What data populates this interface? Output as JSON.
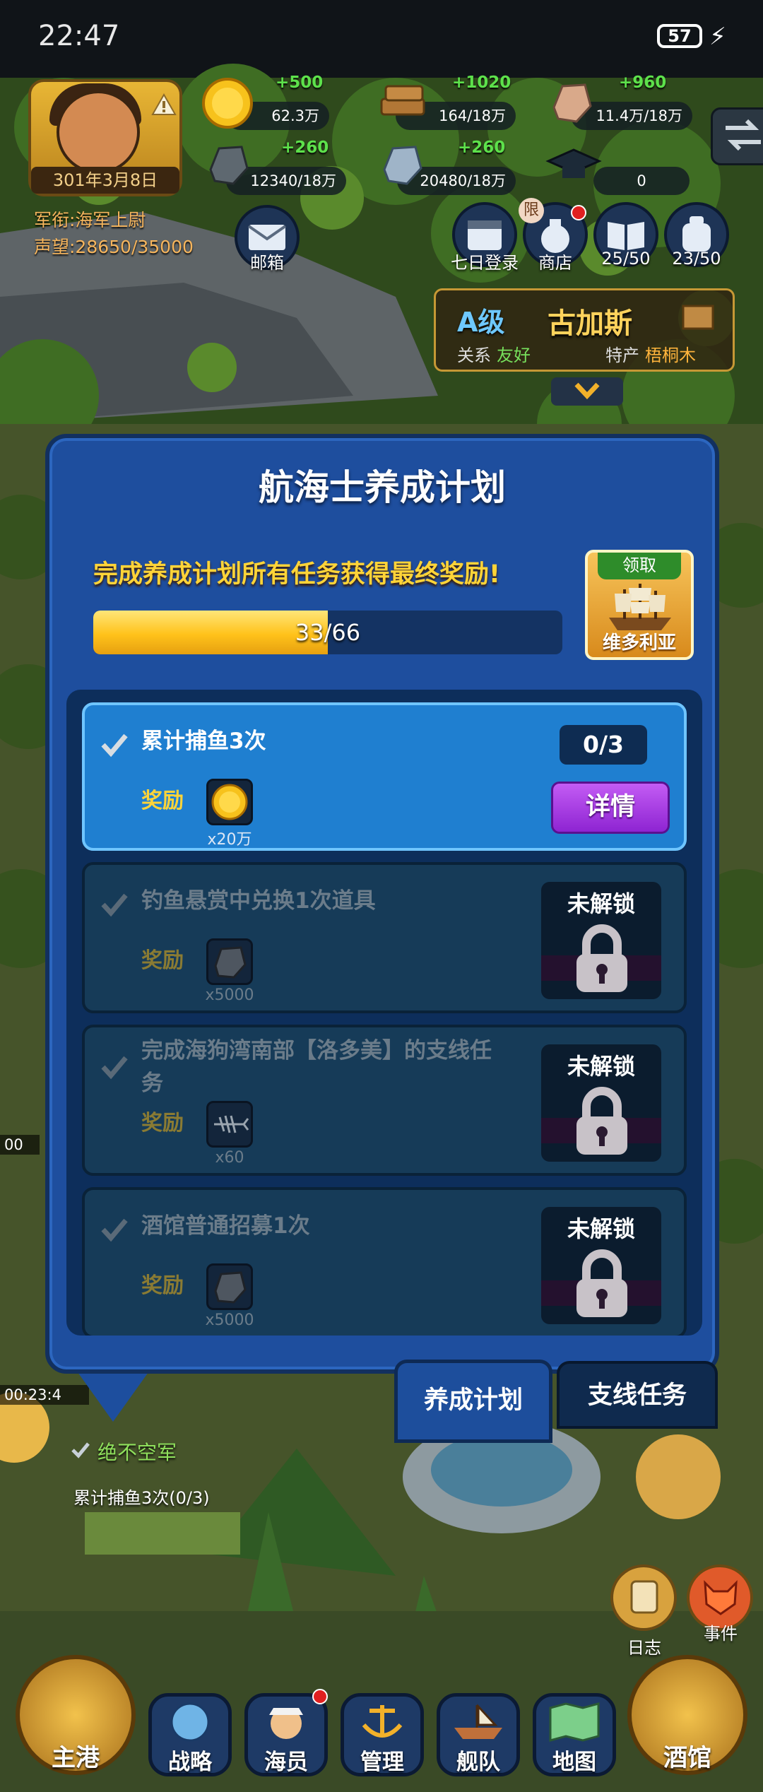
{
  "status_bar": {
    "time": "22:47",
    "battery": "57"
  },
  "player": {
    "date": "301年3月8日",
    "rank": "军衔:海军上尉",
    "prestige": "声望:28650/35000"
  },
  "resources": [
    {
      "icon": "gold-coin-icon",
      "plus": "+500",
      "value": "62.3万"
    },
    {
      "icon": "wood-icon",
      "plus": "+1020",
      "value": "164/18万"
    },
    {
      "icon": "stone-icon",
      "plus": "+960",
      "value": "11.4万/18万"
    },
    {
      "icon": "iron-ore-icon",
      "plus": "+260",
      "value": "12340/18万"
    },
    {
      "icon": "crystal-ore-icon",
      "plus": "+260",
      "value": "20480/18万"
    },
    {
      "icon": "graduation-cap-icon",
      "plus": "",
      "value": "0"
    }
  ],
  "hud_buttons": {
    "mail": "邮箱",
    "seven_day": "七日登录",
    "shop": "商店",
    "shop_badge": "限",
    "books": "25/50",
    "crew": "23/50"
  },
  "region": {
    "grade": "A级",
    "name": "古加斯",
    "relation_label": "关系",
    "relation": "友好",
    "product_label": "特产",
    "product": "梧桐木"
  },
  "modal": {
    "title": "航海士养成计划",
    "subtitle": "完成养成计划所有任务获得最终奖励!",
    "progress_text": "33/66",
    "progress_fraction": 0.5,
    "final_reward": {
      "claim": "领取",
      "name": "维多利亚"
    },
    "reward_label": "奖励",
    "tasks": [
      {
        "name": "累计捕鱼3次",
        "reward_count": "x20万",
        "progress": "0/3",
        "button": "详情"
      },
      {
        "name": "钓鱼悬赏中兑换1次道具",
        "reward_count": "x5000",
        "status": "未解锁"
      },
      {
        "name": "完成海狗湾南部【洛多美】的支线任",
        "name2": "务",
        "reward_count": "x60",
        "status": "未解锁"
      },
      {
        "name": "酒馆普通招募1次",
        "reward_count": "x5000",
        "status": "未解锁"
      }
    ],
    "tabs": {
      "plan": "养成计划",
      "side": "支线任务"
    }
  },
  "tracker": {
    "timer1": "00",
    "timer2": "00:23:4",
    "title": "绝不空军",
    "task": "累计捕鱼3次(0/3)"
  },
  "side_buttons": {
    "log": "日志",
    "event": "事件"
  },
  "nav": {
    "home": "主港",
    "strategy": "战略",
    "crew": "海员",
    "manage": "管理",
    "fleet": "舰队",
    "map": "地图",
    "tavern": "酒馆"
  },
  "colors": {
    "modal_blue": "#1e4e9e",
    "active_task": "#1f7fd0",
    "progress_yellow": "#ffc21a",
    "detail_purple": "#a040e0",
    "reward_text_yellow": "#ffd438"
  }
}
